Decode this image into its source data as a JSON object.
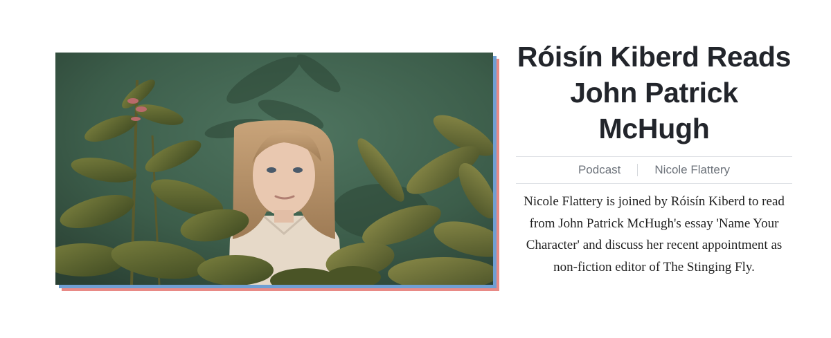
{
  "article": {
    "title": "Róisín Kiberd Reads John Patrick McHugh",
    "category": "Podcast",
    "author": "Nicole Flattery",
    "description": "Nicole Flattery is joined by Róisín Kiberd to read from John Patrick McHugh's essay 'Name Your Character' and discuss her recent appointment as non-fiction editor of The Stinging Fly."
  },
  "image": {
    "icon": "portrait-photo",
    "subject": "woman-among-houseplants"
  },
  "colors": {
    "shadow_blue": "#6f9fd3",
    "shadow_red": "#e88a86",
    "title": "#22252b",
    "meta": "#6c727a",
    "divider": "#dfe2e6"
  }
}
